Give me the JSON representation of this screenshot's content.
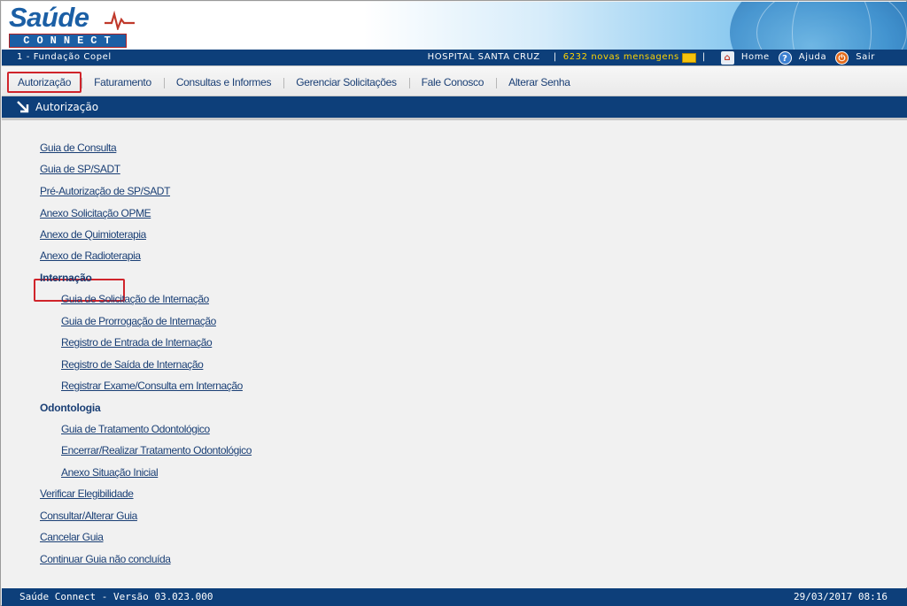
{
  "app": {
    "logo_word": "Saúde",
    "logo_sub": "CONNECT"
  },
  "infobar": {
    "organization": "1 - Fundação Copel",
    "hospital": "HOSPITAL SANTA CRUZ",
    "separator": "|",
    "messages": "6232 novas mensagens",
    "home": "Home",
    "help": "Ajuda",
    "exit": "Sair",
    "icons": [
      "envelope-icon",
      "home-icon",
      "help-icon",
      "exit-icon"
    ]
  },
  "menu": {
    "items": [
      {
        "label": "Autorização",
        "active": true
      },
      {
        "label": "Faturamento"
      },
      {
        "label": "Consultas e Informes"
      },
      {
        "label": "Gerenciar Solicitações"
      },
      {
        "label": "Fale Conosco"
      },
      {
        "label": "Alterar Senha"
      }
    ]
  },
  "section": {
    "title": "Autorização",
    "icon": "arrow-down-right-icon"
  },
  "links": {
    "guia_consulta": "Guia de Consulta",
    "guia_sp_sadt": "Guia de SP/SADT",
    "pre_autorizacao": "Pré-Autorização de SP/SADT",
    "anexo_opme": "Anexo Solicitação OPME",
    "anexo_quimio": "Anexo de Quimioterapia",
    "anexo_radio": "Anexo de Radioterapia",
    "internacao_heading": "Internação",
    "int_solicitacao": "Guia de Solicitação de Internação",
    "int_prorrogacao": "Guia de Prorrogação de Internação",
    "int_entrada": "Registro de Entrada de Internação",
    "int_saida": "Registro de Saída de Internação",
    "int_exame": "Registrar Exame/Consulta em Internação",
    "odonto_heading": "Odontologia",
    "odo_tratamento": "Guia de Tratamento Odontológico",
    "odo_encerrar": "Encerrar/Realizar Tratamento Odontológico",
    "odo_anexo": "Anexo Situação Inicial",
    "elegibilidade": "Verificar Elegibilidade",
    "consultar_alterar": "Consultar/Alterar Guia",
    "cancelar": "Cancelar Guia",
    "continuar": "Continuar Guia não concluída"
  },
  "footer": {
    "version": "Saúde Connect - Versão 03.023.000",
    "datetime": "29/03/2017 08:16"
  },
  "colors": {
    "navy": "#0d3f7a",
    "link": "#1a3f75",
    "highlight": "#d0242b",
    "message_yellow": "#ffd400"
  }
}
